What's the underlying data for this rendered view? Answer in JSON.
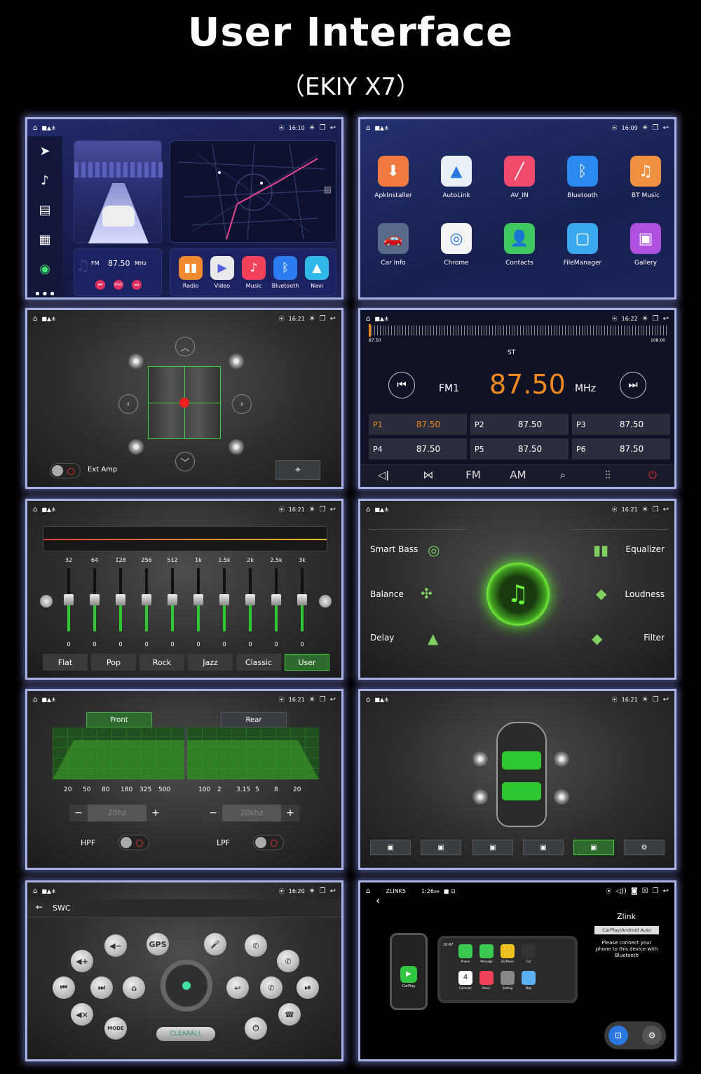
{
  "header": {
    "title": "User Interface",
    "subtitle": "（EKIY X7）"
  },
  "p1": {
    "time": "16:10",
    "fm_band": "FM",
    "freq": "87.50",
    "unit": "MHz",
    "band_btn": "BAND",
    "apps": [
      {
        "label": "Radio",
        "color": "#f08a30"
      },
      {
        "label": "Video",
        "color": "#eaeaea"
      },
      {
        "label": "Music",
        "color": "#f0405a"
      },
      {
        "label": "Bluetooth",
        "color": "#2b7cf0"
      },
      {
        "label": "Navi",
        "color": "#2fb8e8"
      }
    ]
  },
  "p2": {
    "time": "16:09",
    "apps": [
      {
        "label": "ApkInstaller",
        "color": "#f07a40",
        "icon": "⬇"
      },
      {
        "label": "AutoLink",
        "color": "#e8f0f8",
        "icon": "▲"
      },
      {
        "label": "AV_IN",
        "color": "#f04a6a",
        "icon": "╱"
      },
      {
        "label": "Bluetooth",
        "color": "#2b8af0",
        "icon": "ᛒ"
      },
      {
        "label": "BT Music",
        "color": "#f09040",
        "icon": "♫"
      },
      {
        "label": "Car Info",
        "color": "#5a6a8a",
        "icon": "🚗"
      },
      {
        "label": "Chrome",
        "color": "#f4f4f4",
        "icon": "◎"
      },
      {
        "label": "Contacts",
        "color": "#40c860",
        "icon": "👤"
      },
      {
        "label": "FileManager",
        "color": "#3aa8f0",
        "icon": "▢"
      },
      {
        "label": "Gallery",
        "color": "#b050e0",
        "icon": "▣"
      }
    ]
  },
  "p3": {
    "time": "16:21",
    "ext_amp": "Ext Amp"
  },
  "p4": {
    "time": "16:22",
    "scale_min": "87.50",
    "scale_max": "108.00",
    "st": "ST",
    "band": "FM1",
    "freq": "87.50",
    "unit": "MHz",
    "presets": [
      {
        "n": "P1",
        "v": "87.50"
      },
      {
        "n": "P2",
        "v": "87.50"
      },
      {
        "n": "P3",
        "v": "87.50"
      },
      {
        "n": "P4",
        "v": "87.50"
      },
      {
        "n": "P5",
        "v": "87.50"
      },
      {
        "n": "P6",
        "v": "87.50"
      }
    ],
    "bottom": [
      "◁ǀ",
      "⋈",
      "FM",
      "AM",
      "⌕",
      "⫶⫶",
      "⏻"
    ]
  },
  "p5": {
    "time": "16:21",
    "freqs": [
      "32",
      "64",
      "128",
      "256",
      "512",
      "1k",
      "1.5k",
      "2k",
      "2.5k",
      "3k"
    ],
    "values": [
      "0",
      "0",
      "0",
      "0",
      "0",
      "0",
      "0",
      "0",
      "0",
      "0"
    ],
    "presets": [
      "Flat",
      "Pop",
      "Rock",
      "Jazz",
      "Classic",
      "User"
    ]
  },
  "p6": {
    "time": "16:21",
    "left": [
      "Smart Bass",
      "Balance",
      "Delay"
    ],
    "right": [
      "Equalizer",
      "Loudness",
      "Filter"
    ]
  },
  "p7": {
    "time": "16:21",
    "front": "Front",
    "rear": "Rear",
    "front_ticks": [
      "20",
      "50",
      "80",
      "180",
      "325",
      "500"
    ],
    "rear_ticks": [
      "100",
      "2",
      "3.15",
      "5",
      "8",
      "20"
    ],
    "hpf_value": "20hz",
    "lpf_value": "20khz",
    "hpf": "HPF",
    "lpf": "LPF"
  },
  "p8": {
    "time": "16:21"
  },
  "p9": {
    "time": "16:20",
    "title": "SWC",
    "clear": "CLEARALL",
    "gps": "GPS",
    "mode": "MODE"
  },
  "p10": {
    "app": "ZLINK5",
    "time": "1:26",
    "am": "AM",
    "title": "Zlink",
    "badge": "CarPlay/Android Auto",
    "desc": "Please connect your phone to this device with Bluetooth",
    "carplay": "CarPlay",
    "tiles": [
      {
        "label": "Phone",
        "color": "#3ac850"
      },
      {
        "label": "Message",
        "color": "#3ac850"
      },
      {
        "label": "QQ Music",
        "color": "#f0c020"
      },
      {
        "label": "Car",
        "color": "#333"
      },
      {
        "label": "Calendar",
        "color": "#fff"
      },
      {
        "label": "Music",
        "color": "#f0405a"
      },
      {
        "label": "Setting",
        "color": "#888"
      },
      {
        "label": "Map",
        "color": "#5ab0f0"
      }
    ],
    "cal_day": "4",
    "cal_time": "16:47"
  }
}
